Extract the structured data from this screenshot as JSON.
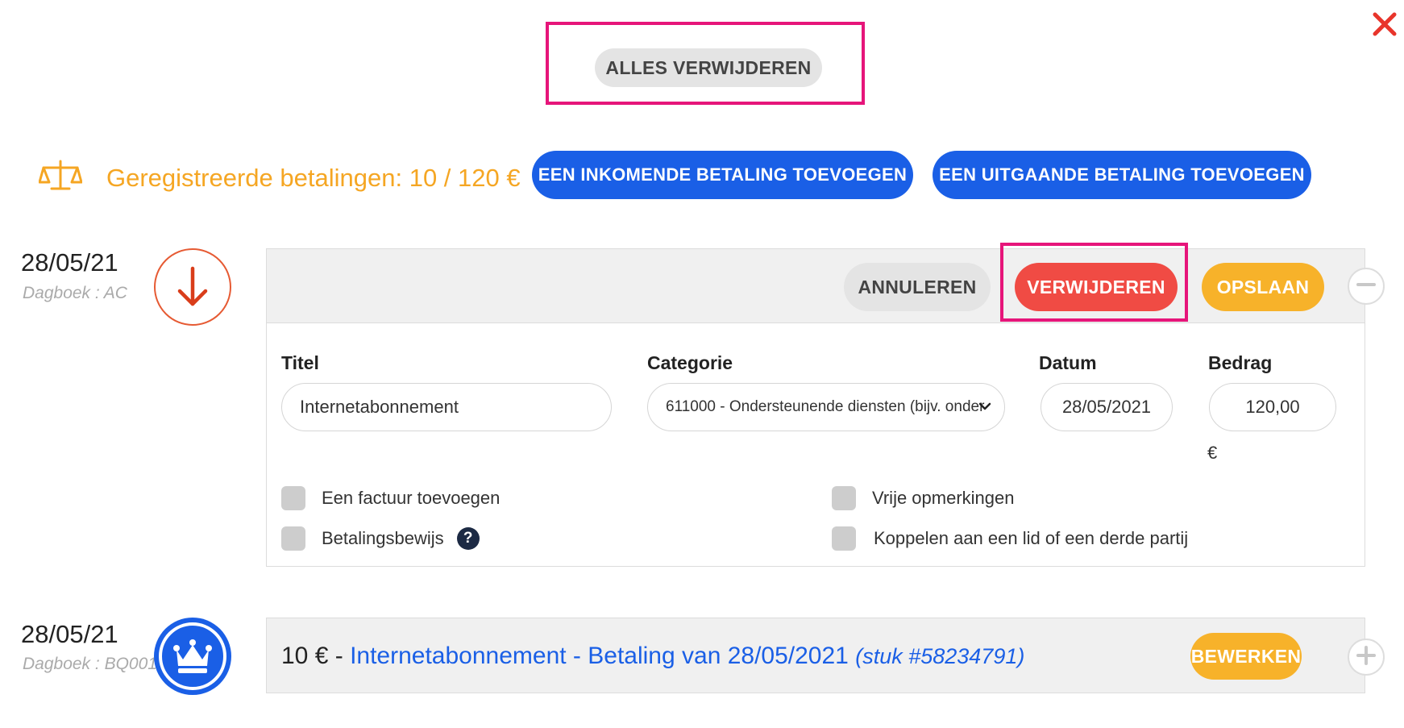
{
  "toolbar": {
    "delete_all_label": "ALLES VERWIJDEREN"
  },
  "summary": {
    "label": "Geregistreerde betalingen:",
    "value": "10 / 120 €"
  },
  "actions": {
    "add_incoming_label": "EEN INKOMENDE BETALING TOEVOEGEN",
    "add_outgoing_label": "EEN UITGAANDE BETALING TOEVOEGEN"
  },
  "entries": [
    {
      "date": "28/05/21",
      "journal": "Dagboek : AC",
      "icon": "arrow-down-icon",
      "buttons": {
        "cancel": "ANNULEREN",
        "delete": "VERWIJDEREN",
        "save": "OPSLAAN"
      },
      "form": {
        "title_label": "Titel",
        "title_value": "Internetabonnement",
        "category_label": "Categorie",
        "category_value": "611000 - Ondersteunende diensten (bijv. onder",
        "date_label": "Datum",
        "date_value": "28/05/2021",
        "amount_label": "Bedrag",
        "amount_value": "120,00",
        "currency": "€"
      },
      "options": {
        "add_invoice": "Een factuur toevoegen",
        "payment_proof": "Betalingsbewijs",
        "free_remarks": "Vrije opmerkingen",
        "link_member": "Koppelen aan een lid of een derde partij"
      }
    },
    {
      "date": "28/05/21",
      "journal": "Dagboek : BQ001",
      "icon": "crown-icon",
      "amount": "10 € -",
      "description": "Internetabonnement - Betaling van 28/05/2021",
      "reference": "(stuk #58234791)",
      "edit_label": "BEWERKEN"
    }
  ],
  "colors": {
    "accent_blue": "#1a5fe6",
    "orange": "#f5a623",
    "danger": "#f04b44",
    "highlight": "#e6157a"
  }
}
